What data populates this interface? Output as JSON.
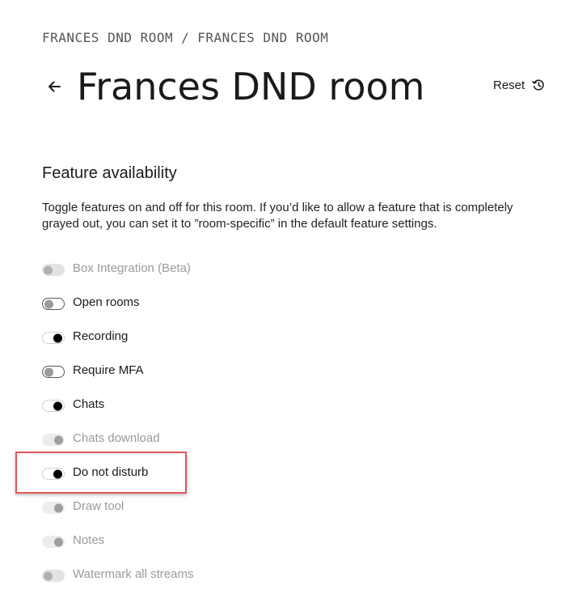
{
  "breadcrumb": {
    "items": [
      "FRANCES DND ROOM",
      "FRANCES DND ROOM"
    ],
    "separator": "/"
  },
  "header": {
    "back_icon": "arrow-left-icon",
    "title": "Frances DND room",
    "reset_label": "Reset",
    "reset_icon": "history-icon"
  },
  "section": {
    "heading": "Feature availability",
    "description": "Toggle features on and off for this room. If you’d like to allow a feature that is completely grayed out, you can set it to ”room-specific” in the default feature settings."
  },
  "features": [
    {
      "label": "Box Integration (Beta)",
      "on": false,
      "disabled": true
    },
    {
      "label": "Open rooms",
      "on": false,
      "disabled": false
    },
    {
      "label": "Recording",
      "on": true,
      "disabled": false
    },
    {
      "label": "Require MFA",
      "on": false,
      "disabled": false
    },
    {
      "label": "Chats",
      "on": true,
      "disabled": false
    },
    {
      "label": "Chats download",
      "on": true,
      "disabled": true
    },
    {
      "label": "Do not disturb",
      "on": true,
      "disabled": false
    },
    {
      "label": "Draw tool",
      "on": true,
      "disabled": true
    },
    {
      "label": "Notes",
      "on": true,
      "disabled": true
    },
    {
      "label": "Watermark all streams",
      "on": false,
      "disabled": true
    }
  ],
  "colors": {
    "highlight": "#e0575b",
    "text": "#1a1a1a",
    "disabled_text": "#9a9a9a"
  }
}
